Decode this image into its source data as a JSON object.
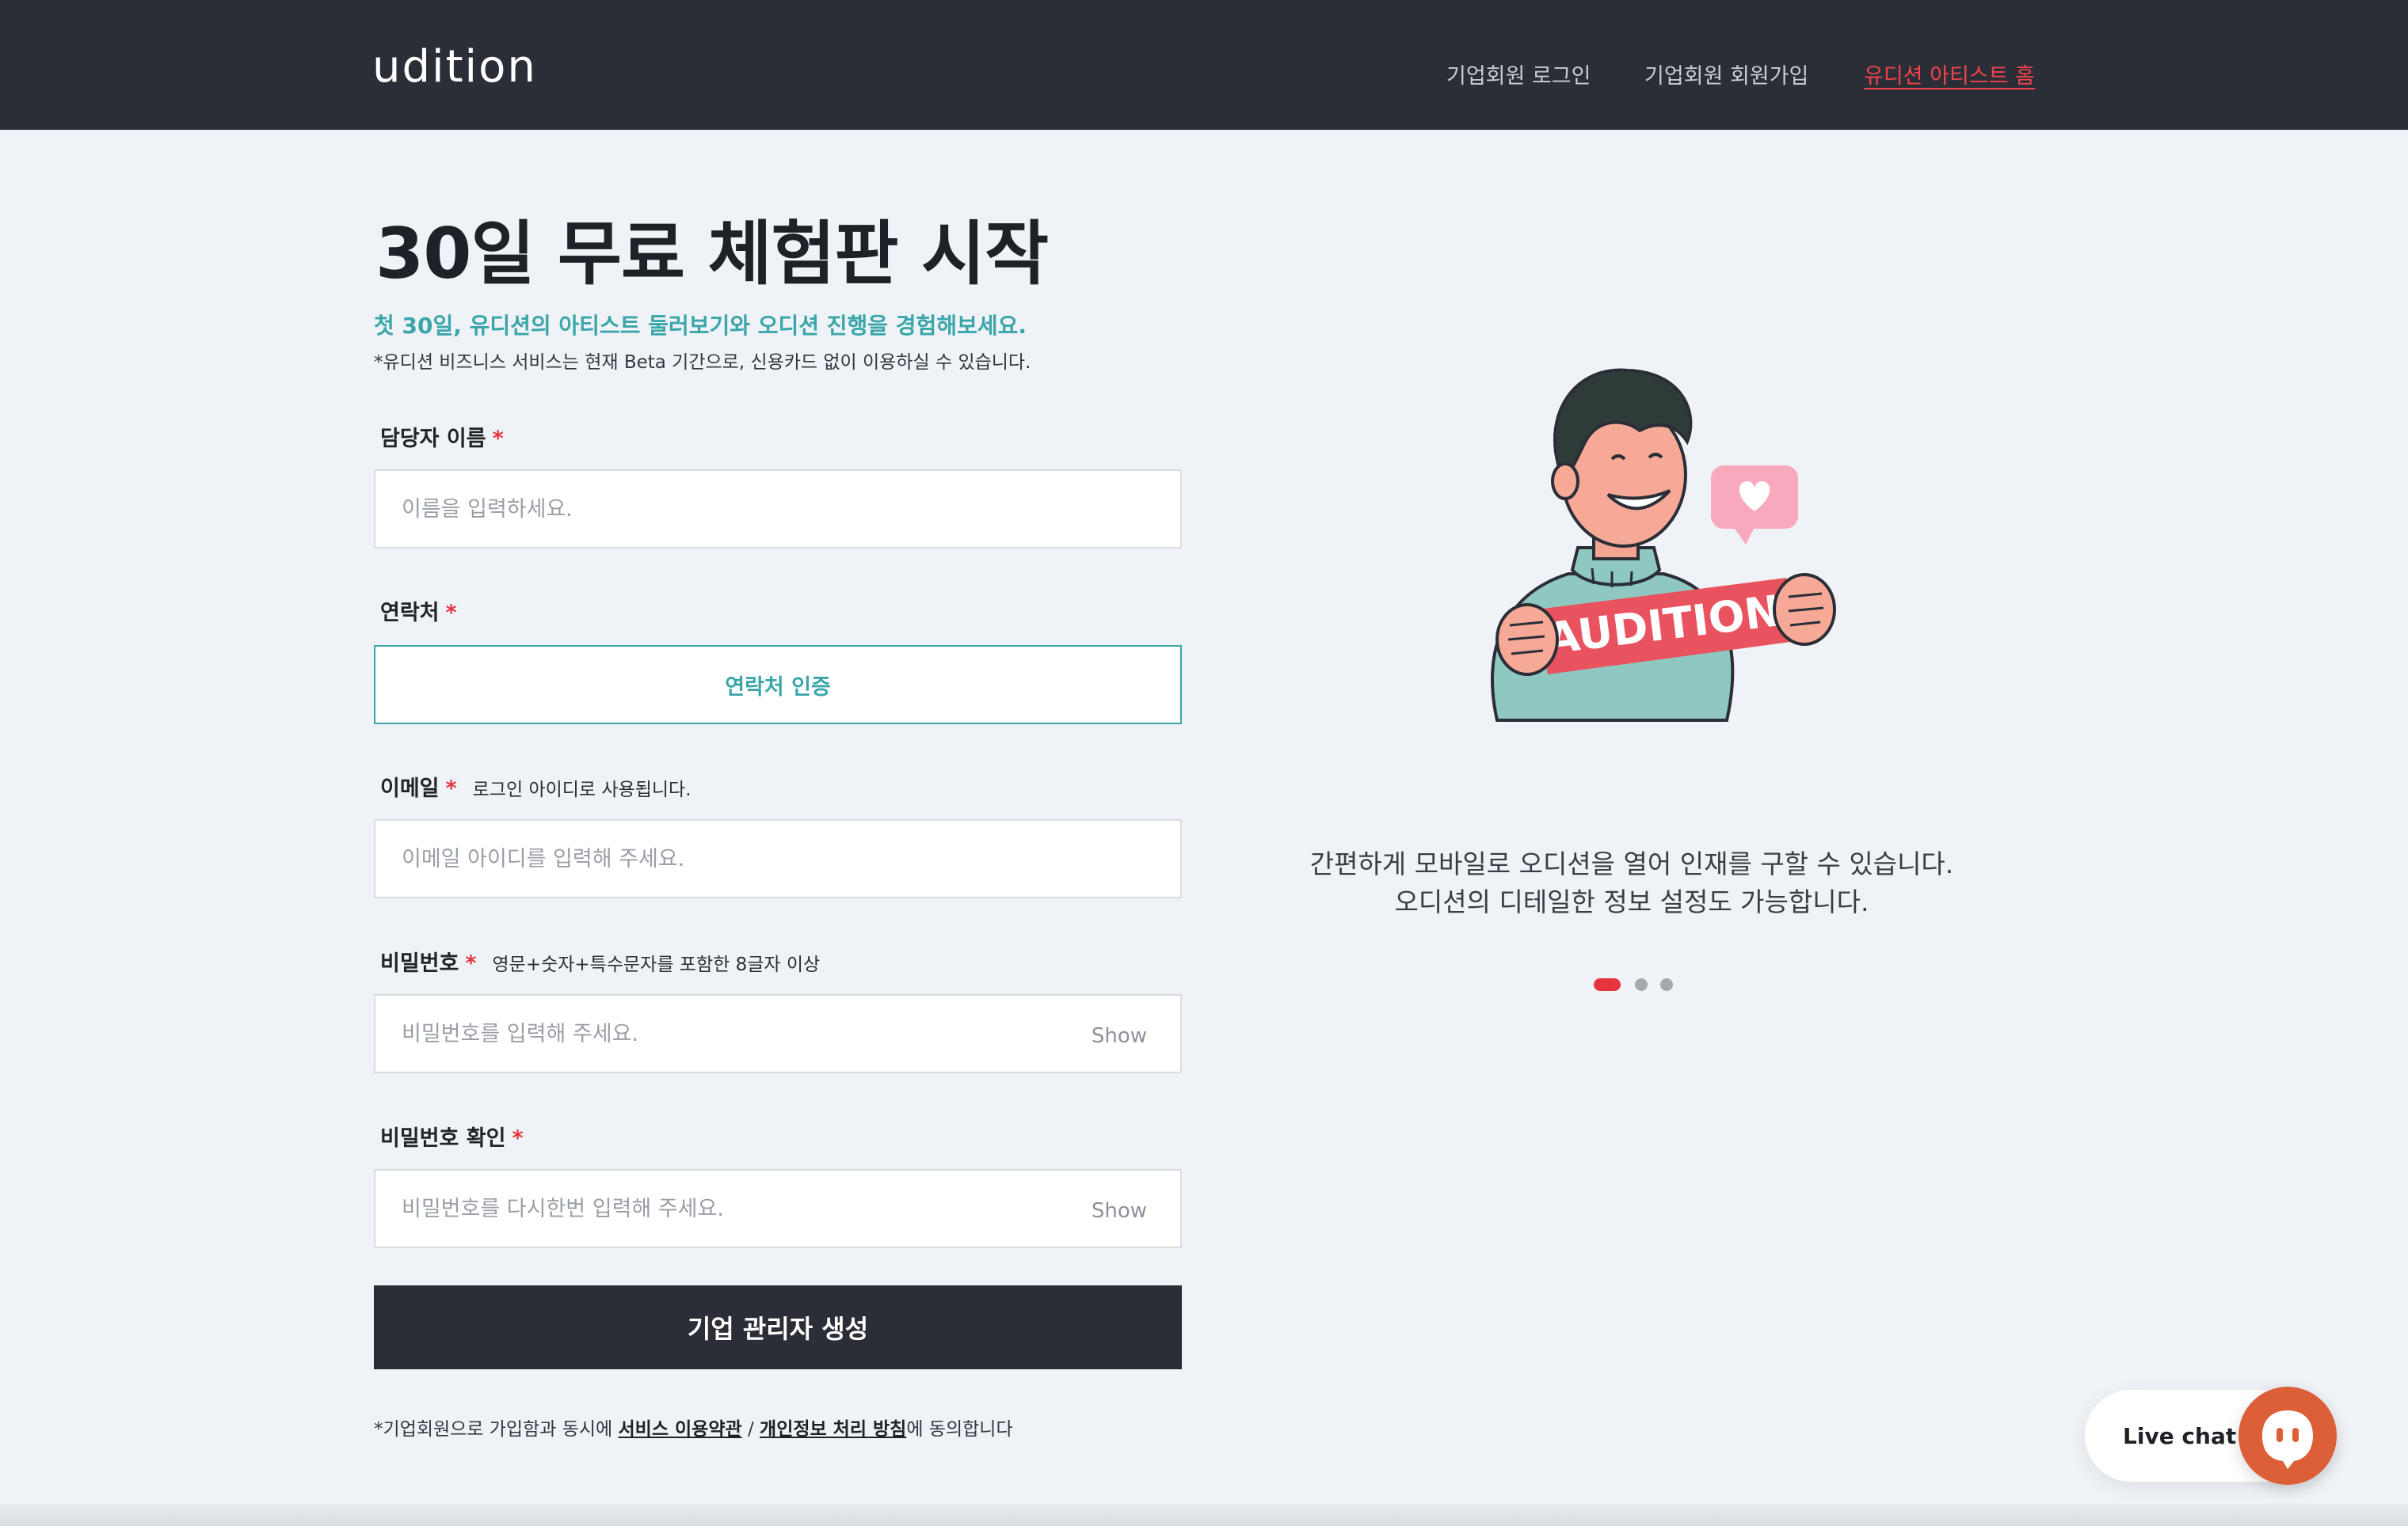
{
  "header": {
    "logo": "udition",
    "nav": [
      "기업회원 로그인",
      "기업회원 회원가입",
      "유디션 아티스트 홈"
    ]
  },
  "form": {
    "title": "30일 무료 체험판 시작",
    "subtitle": "첫 30일, 유디션의 아티스트 둘러보기와 오디션 진행을 경험해보세요.",
    "note": "*유디션 비즈니스 서비스는 현재 Beta 기간으로, 신용카드 없이 이용하실 수 있습니다.",
    "required_mark": "*",
    "name": {
      "label": "담당자 이름",
      "placeholder": "이름을 입력하세요."
    },
    "contact": {
      "label": "연락처",
      "button": "연락처 인증"
    },
    "email": {
      "label": "이메일",
      "hint": "로그인 아이디로 사용됩니다.",
      "placeholder": "이메일 아이디를 입력해 주세요."
    },
    "password": {
      "label": "비밀번호",
      "hint": "영문+숫자+특수문자를 포함한 8글자 이상",
      "placeholder": "비밀번호를 입력해 주세요.",
      "show": "Show"
    },
    "password_confirm": {
      "label": "비밀번호 확인",
      "placeholder": "비밀번호를 다시한번 입력해 주세요.",
      "show": "Show"
    },
    "submit": "기업 관리자 생성",
    "terms": {
      "prefix": "*기업회원으로 가입함과 동시에 ",
      "service_terms": "서비스 이용약관",
      "separator": " / ",
      "privacy": "개인정보 처리 방침",
      "suffix": "에 동의합니다"
    }
  },
  "carousel": {
    "illustration_text": "AUDITION",
    "line1": "간편하게 모바일로 오디션을 열어 인재를 구할 수 있습니다.",
    "line2": "오디션의 디테일한 정보 설정도 가능합니다.",
    "slide_count": 3,
    "active_index": 0,
    "active_color": "#e4343d"
  },
  "live_chat": {
    "label": "Live chat"
  },
  "colors": {
    "accent": "#3aa6a9",
    "required": "#e4343d",
    "header_bg": "#2b2e37",
    "page_bg": "#eff2f6"
  }
}
